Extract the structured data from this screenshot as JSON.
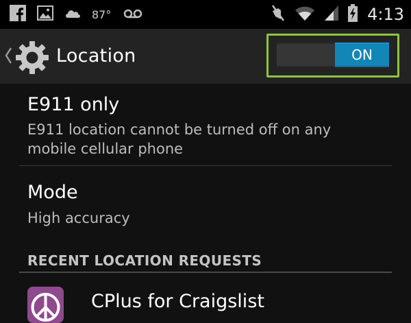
{
  "status_bar": {
    "temperature": "87°",
    "time": "4:13",
    "icons": [
      "facebook-icon",
      "image-icon",
      "weather-cloud-icon",
      "voicemail-icon",
      "mute-icon",
      "wifi-icon",
      "signal-icon",
      "battery-charging-icon"
    ]
  },
  "action_bar": {
    "title": "Location",
    "toggle": {
      "label": "ON",
      "state": "on"
    },
    "icons": [
      "back-caret-icon",
      "settings-gear-icon"
    ]
  },
  "list": {
    "e911": {
      "title": "E911 only",
      "subtitle_line1": "E911 location cannot be turned off on any",
      "subtitle_line2": "mobile cellular phone"
    },
    "mode": {
      "title": "Mode",
      "subtitle": "High accuracy"
    }
  },
  "recent_requests": {
    "header": "RECENT LOCATION REQUESTS",
    "items": [
      {
        "app": "CPlus for Craigslist",
        "icon": "cplus-app-icon"
      }
    ]
  },
  "colors": {
    "background": "#111111",
    "status_bar": "#000000",
    "action_bar": "#232323",
    "toggle_on": "#1386b8",
    "highlight": "#8cc63f",
    "app_icon": "#8e4a8c"
  }
}
